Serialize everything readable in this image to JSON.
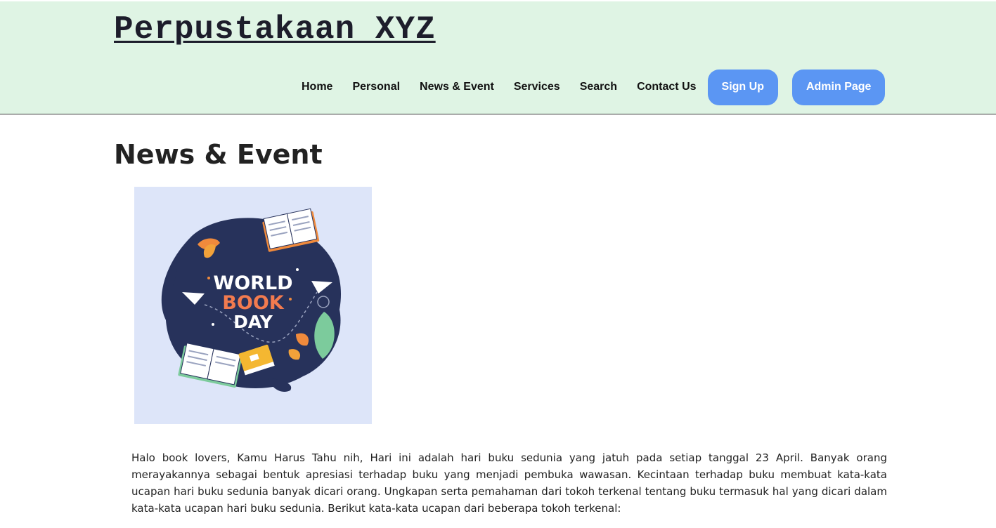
{
  "header": {
    "site_title": "Perpustakaan XYZ",
    "background_color": "#dff4e4"
  },
  "nav": {
    "links": [
      "Home",
      "Personal",
      "News & Event",
      "Services",
      "Search",
      "Contact Us"
    ],
    "signup_label": "Sign Up",
    "admin_label": "Admin Page",
    "button_color": "#5b96f3"
  },
  "main": {
    "heading": "News & Event",
    "image": {
      "line1": "WORLD",
      "line2": "BOOK",
      "line3": "DAY"
    },
    "article_text": "Halo book lovers, Kamu Harus Tahu nih, Hari ini adalah hari buku sedunia yang jatuh pada setiap tanggal 23 April. Banyak orang merayakannya sebagai bentuk apresiasi terhadap buku yang menjadi pembuka wawasan. Kecintaan terhadap buku membuat kata-kata ucapan hari buku sedunia banyak dicari orang. Ungkapan serta pemahaman dari tokoh terkenal tentang buku termasuk hal yang dicari dalam kata-kata ucapan hari buku sedunia. Berikut kata-kata ucapan dari beberapa tokoh terkenal:"
  }
}
